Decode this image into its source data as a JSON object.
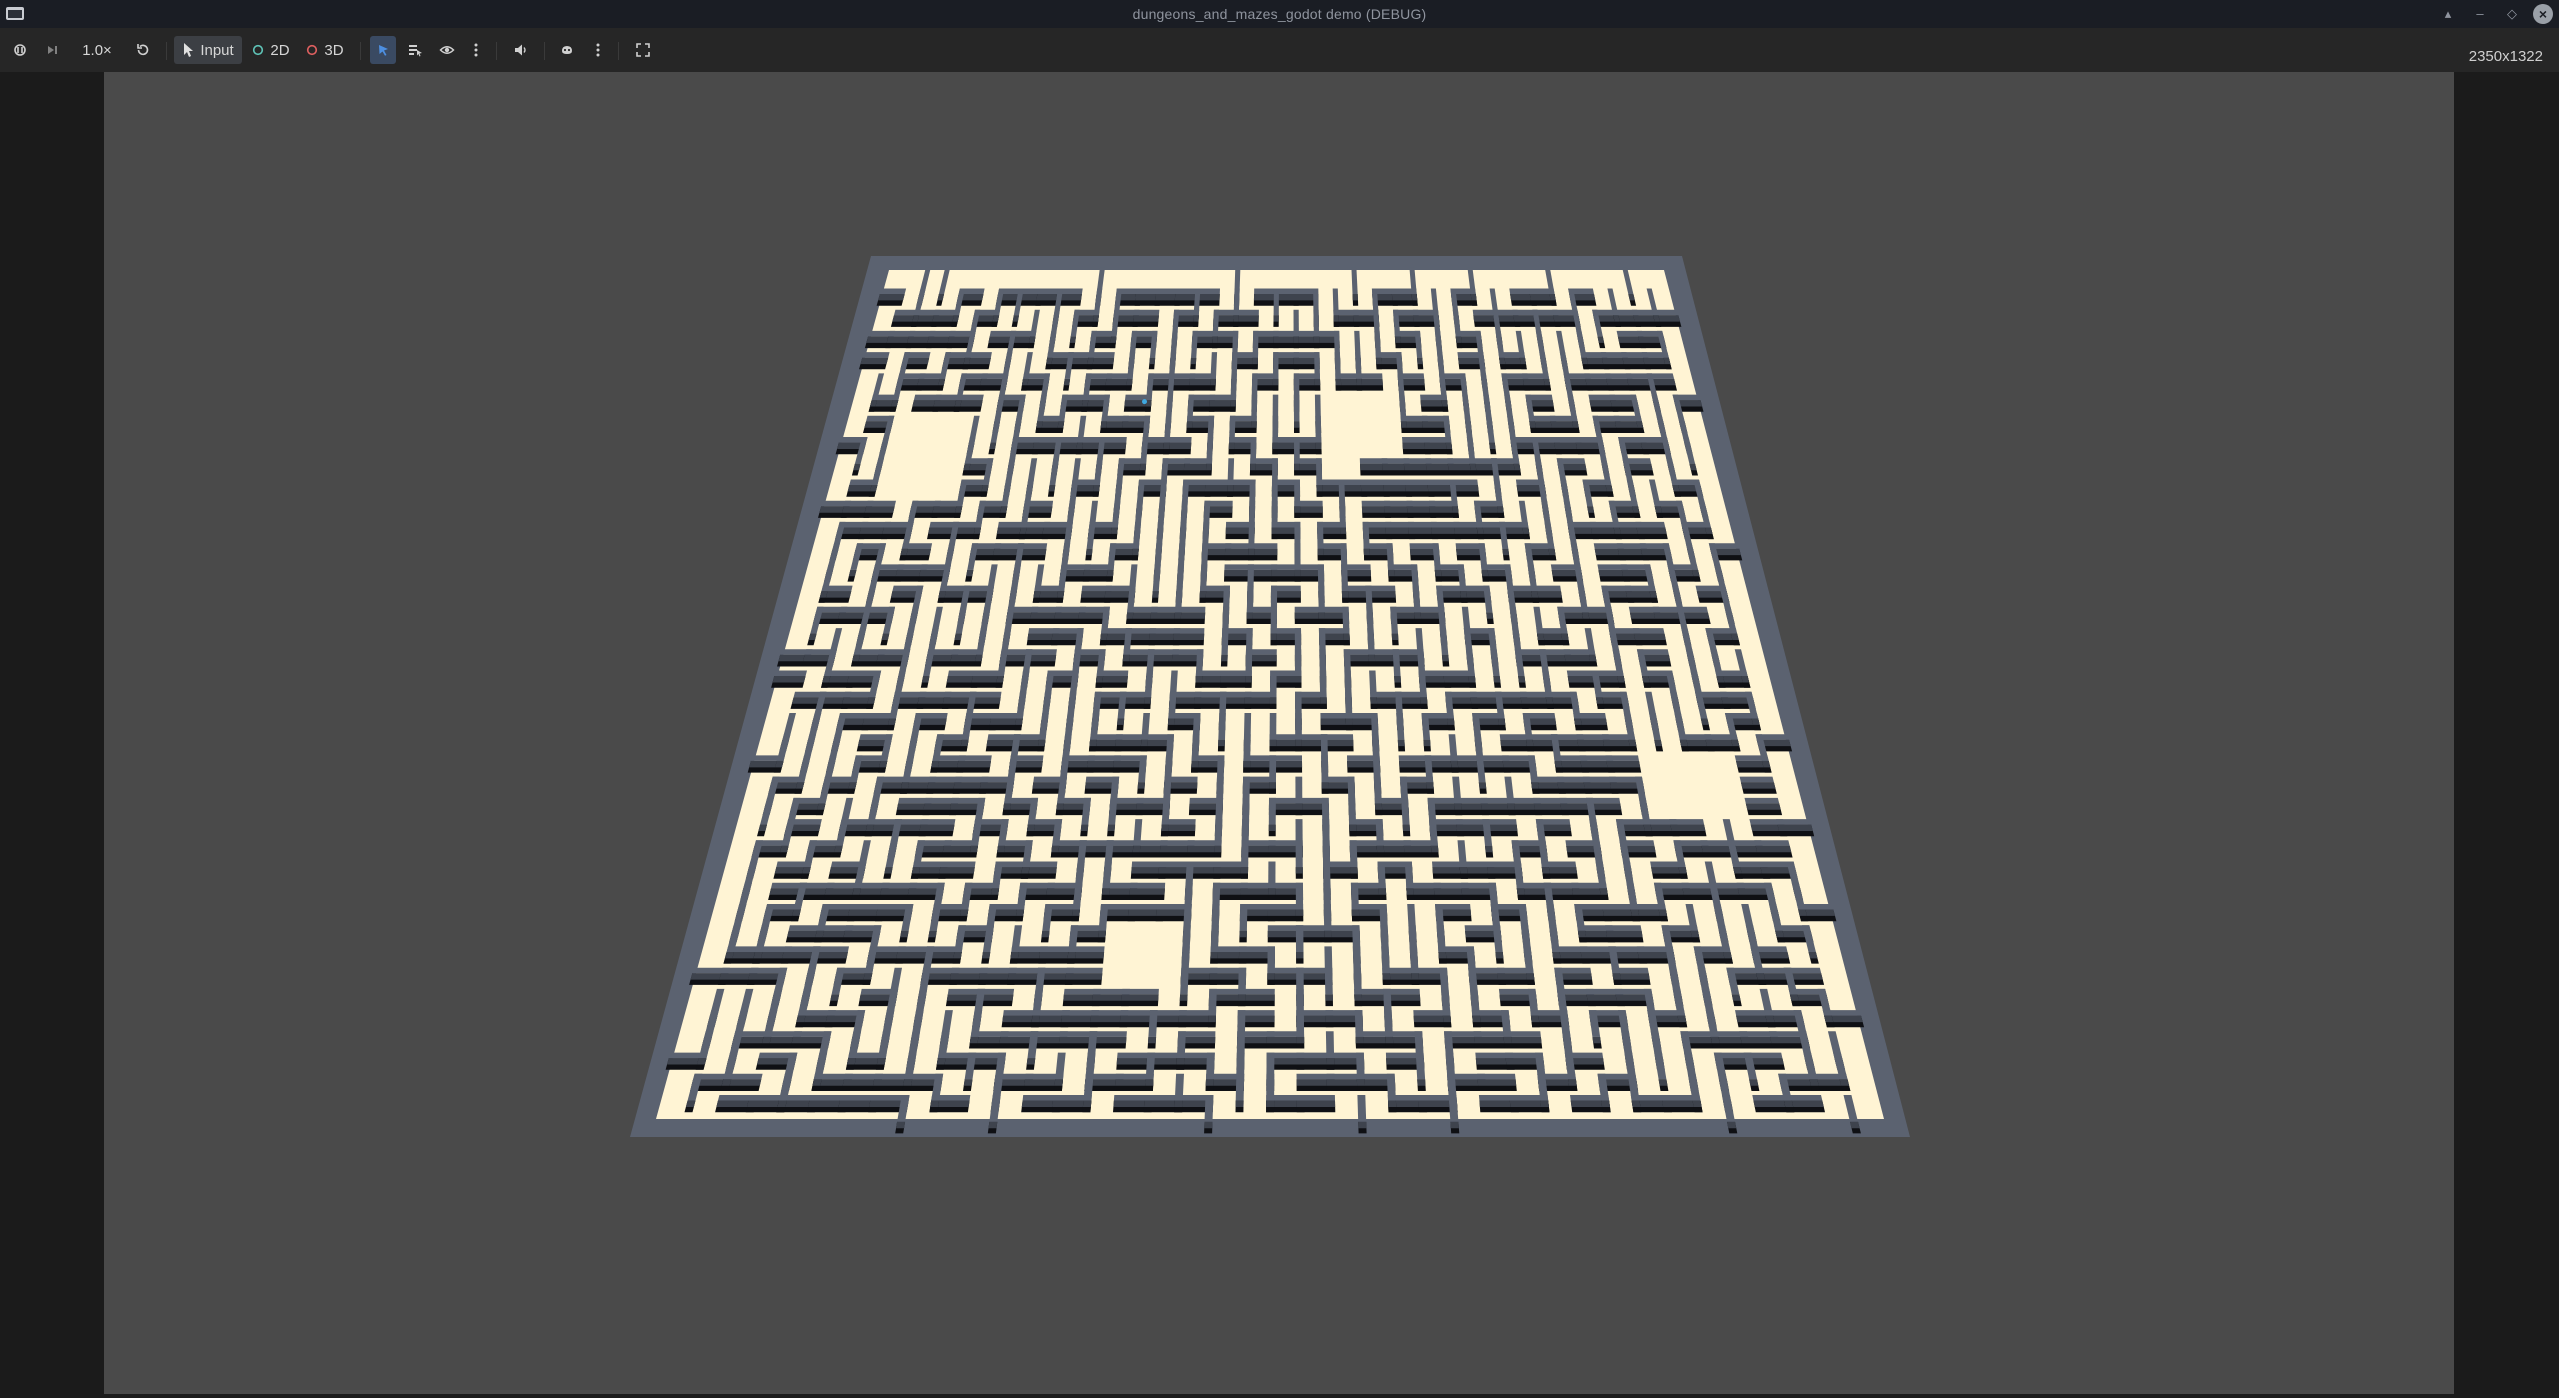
{
  "window": {
    "title": "dungeons_and_mazes_godot demo (DEBUG)"
  },
  "toolbar": {
    "speed_label": "1.0×",
    "input_label": "Input",
    "mode_2d_label": "2D",
    "mode_3d_label": "3D",
    "resolution": "2350x1322"
  },
  "icons": {
    "suspend": "suspend-icon",
    "next_frame": "next-frame-icon",
    "reset_speed": "reset-icon",
    "input_mode": "input-cursor-icon",
    "select": "select-arrow-icon",
    "list_select": "list-select-icon",
    "camera_override": "eye-icon",
    "menu": "kebab-menu-icon",
    "audio": "speaker-icon",
    "embed": "embed-options-icon",
    "fullscreen": "fullscreen-icon"
  },
  "colors": {
    "maze_floor": "#fff4d4",
    "maze_wall_top": "#5b6270",
    "maze_wall_side": "#3e434d",
    "maze_shadow": "#0f1014",
    "background": "#4a4a4a",
    "accent_2d": "#5fc4b8",
    "accent_3d": "#e06060",
    "active_select": "#4d8fe0"
  }
}
